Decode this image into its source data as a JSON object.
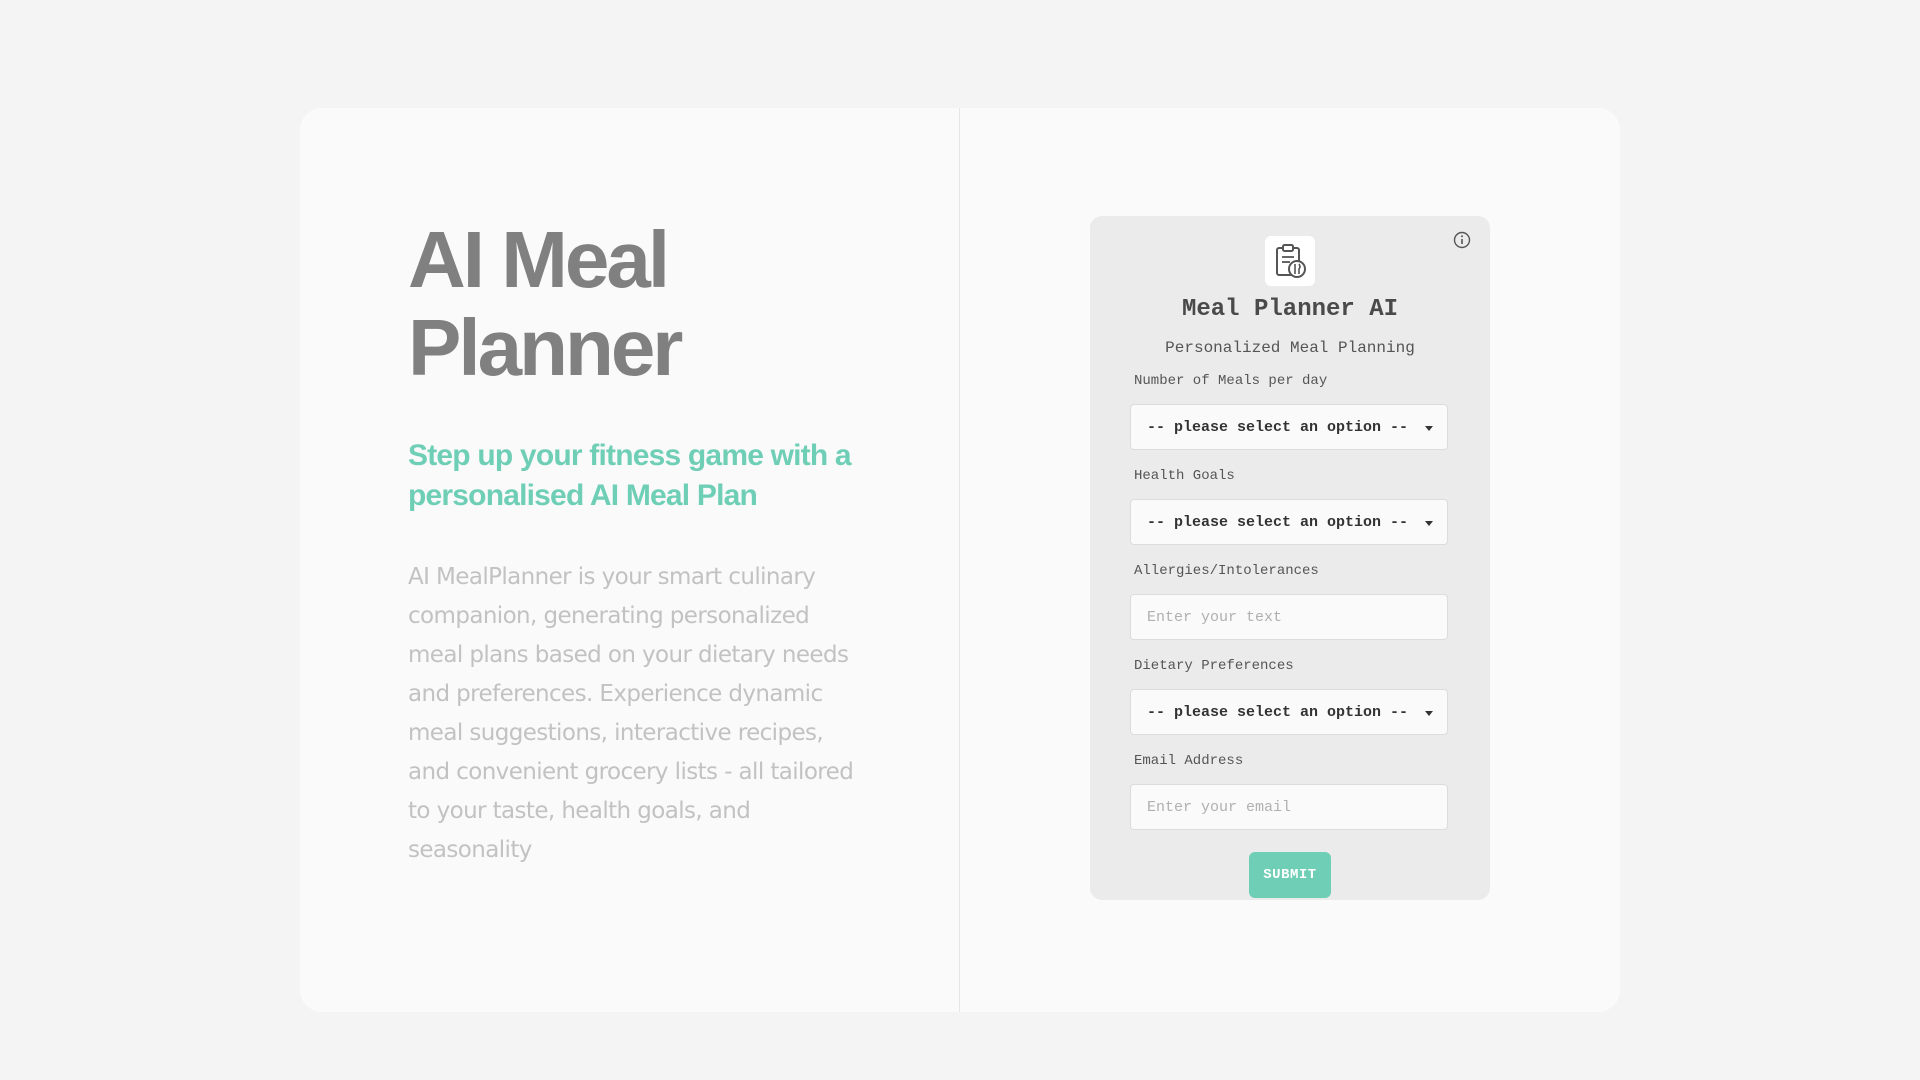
{
  "hero": {
    "title": "AI Meal Planner",
    "tagline": "Step up your fitness game with a personalised AI Meal Plan",
    "description": "AI MealPlanner is your smart culinary companion, generating personalized meal plans based on your dietary needs and preferences. Experience dynamic meal suggestions, interactive recipes, and convenient grocery lists - all tailored to your taste, health goals, and seasonality"
  },
  "form": {
    "title": "Meal Planner AI",
    "subtitle": "Personalized Meal Planning",
    "info_icon": "info-icon",
    "logo_icon": "clipboard-meal-icon",
    "fields": {
      "meals": {
        "label": "Number of Meals per day",
        "selected": "-- please select an option --"
      },
      "goals": {
        "label": "Health Goals",
        "selected": "-- please select an option --"
      },
      "allergies": {
        "label": "Allergies/Intolerances",
        "placeholder": "Enter your text",
        "value": ""
      },
      "diet": {
        "label": "Dietary Preferences",
        "selected": "-- please select an option --"
      },
      "email": {
        "label": "Email Address",
        "placeholder": "Enter your email",
        "value": ""
      }
    },
    "submit_label": "SUBMIT"
  },
  "colors": {
    "accent": "#6fcfb6",
    "title_gray": "#808080",
    "body_gray": "#c2c2c2",
    "panel_bg": "#ebebeb"
  }
}
